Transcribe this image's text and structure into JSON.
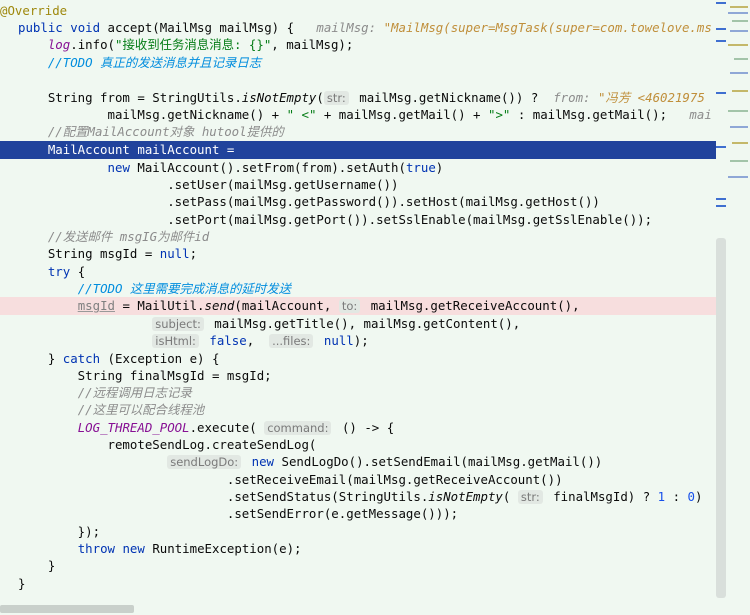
{
  "editor": {
    "l0": [
      "@Override"
    ],
    "l1": [
      "public",
      " ",
      "void",
      " accept(MailMsg mailMsg) {",
      "   mailMsg: ",
      "\"MailMsg(super=MsgTask(super=com.towelove.ms"
    ],
    "l2": [
      "    ",
      "log",
      ".info(",
      "\"接收到任务消息消息: {}\"",
      ", mailMsg);"
    ],
    "l3": [
      "    ",
      "//TODO 真正的发送消息并且记录日志"
    ],
    "l5": [
      "    String from = StringUtils.",
      "isNotEmpty",
      "(",
      "str:",
      " mailMsg.getNickname()) ?  ",
      "from: ",
      "\"冯芳 <46021975"
    ],
    "l6": [
      "            mailMsg.getNickname() + ",
      "\" <\"",
      " + mailMsg.getMail() + ",
      "\">\"",
      " : mailMsg.getMail();   ",
      "mai"
    ],
    "l7": [
      "    ",
      "//配置MailAccount对象 hutool提供的"
    ],
    "l8": [
      "    MailAccount mailAccount ="
    ],
    "l9": [
      "            ",
      "new",
      " MailAccount().setFrom(from).setAuth(",
      "true",
      ")"
    ],
    "l10": [
      "                    .setUser(mailMsg.getUsername())"
    ],
    "l11": [
      "                    .setPass(mailMsg.getPassword()).setHost(mailMsg.getHost())"
    ],
    "l12": [
      "                    .setPort(mailMsg.getPort()).setSslEnable(mailMsg.getSslEnable());"
    ],
    "l13": [
      "    ",
      "//发送邮件 msgIG为邮件id"
    ],
    "l14": [
      "    String msgId = ",
      "null",
      ";"
    ],
    "l15": [
      "    ",
      "try",
      " {"
    ],
    "l16": [
      "        ",
      "//TODO 这里需要完成消息的延时发送"
    ],
    "l17": [
      "        ",
      "msgId",
      " = MailUtil.",
      "send",
      "(mailAccount, ",
      "to:",
      " mailMsg.getReceiveAccount(),"
    ],
    "l18": [
      "                  ",
      "subject:",
      " mailMsg.getTitle(), mailMsg.getContent(),"
    ],
    "l19": [
      "                  ",
      "isHtml:",
      " ",
      "false",
      ",  ",
      "...files:",
      " ",
      "null",
      ");"
    ],
    "l20": [
      "    } ",
      "catch",
      " (Exception e) {"
    ],
    "l21": [
      "        String finalMsgId = msgId;"
    ],
    "l22": [
      "        ",
      "//远程调用日志记录"
    ],
    "l23": [
      "        ",
      "//这里可以配合线程池"
    ],
    "l24": [
      "        ",
      "LOG_THREAD_POOL",
      ".execute( ",
      "command:",
      " () -> {"
    ],
    "l25": [
      "            remoteSendLog.createSendLog("
    ],
    "l26": [
      "                    ",
      "sendLogDo:",
      " ",
      "new",
      " SendLogDo().setSendEmail(mailMsg.getMail())"
    ],
    "l27": [
      "                            .setReceiveEmail(mailMsg.getReceiveAccount())"
    ],
    "l28": [
      "                            .setSendStatus(StringUtils.",
      "isNotEmpty",
      "( ",
      "str:",
      " finalMsgId) ? ",
      "1",
      " : ",
      "0",
      ")"
    ],
    "l29": [
      "                            .setSendError(e.getMessage()));"
    ],
    "l30": [
      "        });"
    ],
    "l31": [
      "        ",
      "throw",
      " ",
      "new",
      " RuntimeException(e);"
    ],
    "l32": [
      "    }"
    ],
    "l33": [
      "}"
    ]
  },
  "colors": {
    "background": "#f0f8f1",
    "selection": "#21439c",
    "error_line": "#f7dede",
    "keyword": "#0033b3",
    "string": "#067d17",
    "comment": "#8c8c8c"
  }
}
